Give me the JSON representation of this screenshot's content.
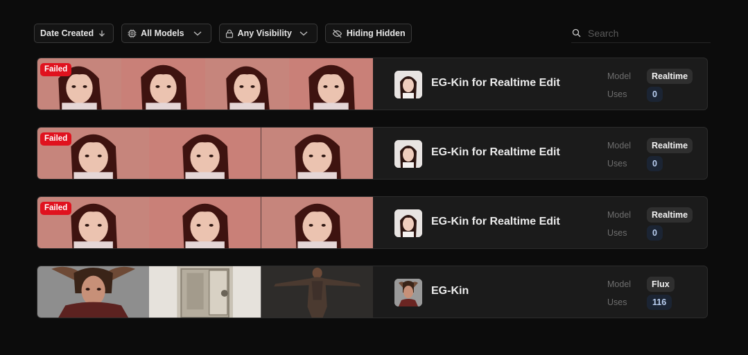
{
  "toolbar": {
    "sort_label": "Date Created",
    "models_label": "All Models",
    "visibility_label": "Any Visibility",
    "hidden_label": "Hiding Hidden"
  },
  "search": {
    "placeholder": "Search"
  },
  "labels": {
    "model": "Model",
    "uses": "Uses"
  },
  "items": [
    {
      "status": "Failed",
      "name": "EG-Kin for Realtime Edit",
      "model": "Realtime",
      "uses": "0"
    },
    {
      "status": "Failed",
      "name": "EG-Kin for Realtime Edit",
      "model": "Realtime",
      "uses": "0"
    },
    {
      "status": "Failed",
      "name": "EG-Kin for Realtime Edit",
      "model": "Realtime",
      "uses": "0"
    },
    {
      "status": "",
      "name": "EG-Kin",
      "model": "Flux",
      "uses": "116"
    }
  ],
  "colors": {
    "failed_badge": "#e0121e",
    "thumb_pink": "#c9837b",
    "uses_pill_bg": "#1b2433",
    "uses_pill_text": "#b9cef0"
  }
}
